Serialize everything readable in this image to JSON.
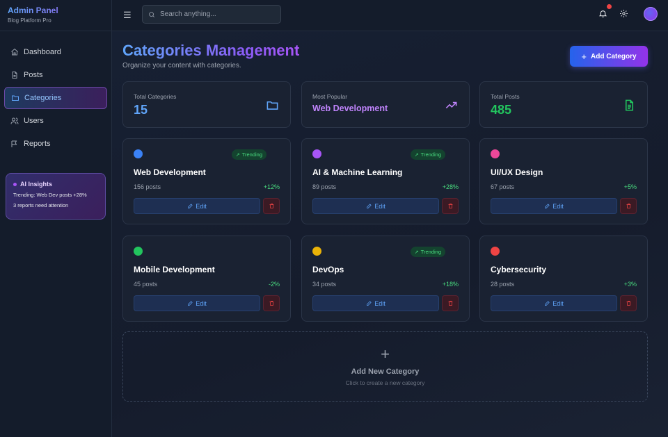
{
  "brand": {
    "title": "Admin Panel",
    "subtitle": "Blog Platform Pro"
  },
  "sidebar": {
    "items": [
      {
        "label": "Dashboard",
        "icon": "home-icon",
        "active": false
      },
      {
        "label": "Posts",
        "icon": "file-icon",
        "active": false
      },
      {
        "label": "Categories",
        "icon": "folder-icon",
        "active": true
      },
      {
        "label": "Users",
        "icon": "users-icon",
        "active": false
      },
      {
        "label": "Reports",
        "icon": "flag-icon",
        "active": false
      }
    ],
    "insights": {
      "title": "AI Insights",
      "line1": "Trending: Web Dev posts +28%",
      "line2": "3 reports need attention"
    }
  },
  "topbar": {
    "menu_icon": "hamburger-icon",
    "search_placeholder": "Search anything...",
    "search_value": ""
  },
  "header": {
    "title": "Categories Management",
    "subtitle": "Organize your content with categories.",
    "add_button": "Add Category"
  },
  "stats": {
    "total_categories": {
      "label": "Total Categories",
      "value": "15",
      "color": "#60a5fa"
    },
    "most_popular": {
      "label": "Most Popular",
      "value": "Web Development",
      "color": "#c084fc"
    },
    "total_posts": {
      "label": "Total Posts",
      "value": "485",
      "color": "#22c55e"
    }
  },
  "trending_label": "Trending",
  "edit_label": "Edit",
  "categories": [
    {
      "name": "Web Development",
      "posts": "156 posts",
      "change": "+12%",
      "color": "#3b82f6",
      "trending": true
    },
    {
      "name": "AI & Machine Learning",
      "posts": "89 posts",
      "change": "+28%",
      "color": "#a855f7",
      "trending": true
    },
    {
      "name": "UI/UX Design",
      "posts": "67 posts",
      "change": "+5%",
      "color": "#ec4899",
      "trending": false
    },
    {
      "name": "Mobile Development",
      "posts": "45 posts",
      "change": "-2%",
      "color": "#22c55e",
      "trending": false
    },
    {
      "name": "DevOps",
      "posts": "34 posts",
      "change": "+18%",
      "color": "#eab308",
      "trending": true
    },
    {
      "name": "Cybersecurity",
      "posts": "28 posts",
      "change": "+3%",
      "color": "#ef4444",
      "trending": false
    }
  ],
  "new_category": {
    "title": "Add New Category",
    "subtitle": "Click to create a new category"
  }
}
